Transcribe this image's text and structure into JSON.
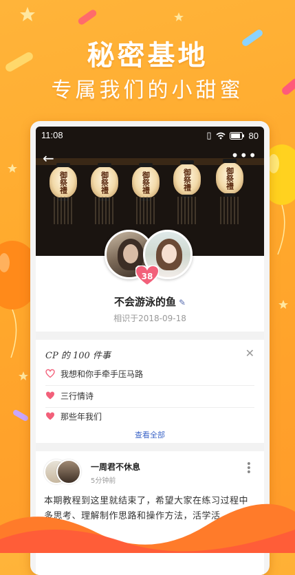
{
  "promo": {
    "headline": "秘密基地",
    "subheadline": "专属我们的小甜蜜"
  },
  "status_bar": {
    "time": "11:08",
    "battery": "80"
  },
  "hero": {
    "lantern_text": "御祭禮"
  },
  "profile": {
    "intimacy_score": "38",
    "name": "不会游泳的鱼",
    "since": "相识于2018-09-18"
  },
  "cp_list": {
    "title": "CP 的 100 件事",
    "items": [
      {
        "label": "我想和你手牵手压马路",
        "done": false
      },
      {
        "label": "三行情诗",
        "done": true
      },
      {
        "label": "那些年我们",
        "done": true
      }
    ],
    "view_all": "查看全部"
  },
  "post": {
    "author": "一周君不休息",
    "time": "5分钟前",
    "body": "本期教程到这里就结束了，希望大家在练习过程中多思考、理解制作思路和操作方法，活学活"
  },
  "colors": {
    "background": "#ffa92c",
    "heart": "#f2607a",
    "link": "#3f67c8"
  }
}
